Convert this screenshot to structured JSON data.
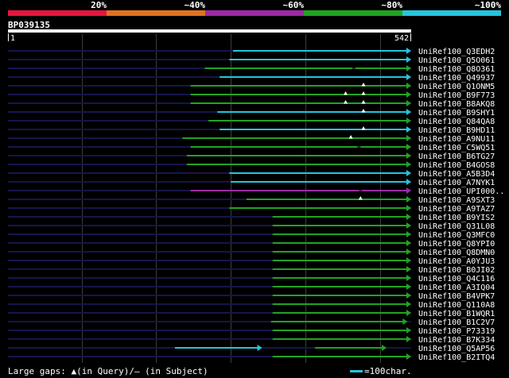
{
  "chart_data": {
    "type": "bar",
    "title": "BP039135",
    "xlim": [
      1,
      542
    ],
    "x_tick_labels": [
      "1",
      "542"
    ],
    "grid": true,
    "grid_interval": 100,
    "query_color": "#ffffff",
    "unaligned_color": "#15154d",
    "identity_scale": [
      {
        "label": "20%",
        "color": "#e6153f"
      },
      {
        "label": "~40%",
        "color": "#e0731f"
      },
      {
        "label": "~60%",
        "color": "#9c2aa3"
      },
      {
        "label": "~80%",
        "color": "#22a322"
      },
      {
        "label": "~100%",
        "color": "#26c4dc"
      }
    ],
    "alignments": [
      {
        "name": "UniRef100_Q3EDH2",
        "segments": [
          {
            "start": 303,
            "end": 542,
            "color": "#26c4dc"
          }
        ]
      },
      {
        "name": "UniRef100_Q5O061",
        "segments": [
          {
            "start": 298,
            "end": 542,
            "color": "#26c4dc"
          }
        ]
      },
      {
        "name": "UniRef100_Q8O361",
        "segments": [
          {
            "start": 265,
            "end": 542,
            "color": "#22a322"
          }
        ],
        "subject_gaps": [
          465
        ]
      },
      {
        "name": "UniRef100_Q49937",
        "segments": [
          {
            "start": 285,
            "end": 542,
            "color": "#26c4dc"
          }
        ]
      },
      {
        "name": "UniRef100_Q1ONM5",
        "segments": [
          {
            "start": 246,
            "end": 542,
            "color": "#22a322"
          }
        ],
        "query_gaps": [
          478
        ]
      },
      {
        "name": "UniRef100_B9F773",
        "segments": [
          {
            "start": 246,
            "end": 542,
            "color": "#22a322"
          }
        ],
        "query_gaps": [
          454,
          478
        ]
      },
      {
        "name": "UniRef100_B8AKQ8",
        "segments": [
          {
            "start": 246,
            "end": 542,
            "color": "#22a322"
          }
        ],
        "query_gaps": [
          454,
          478
        ]
      },
      {
        "name": "UniRef100_B9SHY1",
        "segments": [
          {
            "start": 282,
            "end": 542,
            "color": "#26c4dc"
          }
        ],
        "query_gaps": [
          478
        ]
      },
      {
        "name": "UniRef100_Q84QA8",
        "segments": [
          {
            "start": 270,
            "end": 542,
            "color": "#22a322"
          }
        ]
      },
      {
        "name": "UniRef100_B9HD11",
        "segments": [
          {
            "start": 285,
            "end": 542,
            "color": "#26c4dc"
          }
        ],
        "query_gaps": [
          478
        ]
      },
      {
        "name": "UniRef100_A9NU11",
        "segments": [
          {
            "start": 235,
            "end": 542,
            "color": "#22a322"
          }
        ],
        "query_gaps": [
          461
        ]
      },
      {
        "name": "UniRef100_C5WQ51",
        "segments": [
          {
            "start": 246,
            "end": 542,
            "color": "#22a322"
          }
        ],
        "subject_gaps": [
          472
        ]
      },
      {
        "name": "UniRef100_B6TG27",
        "segments": [
          {
            "start": 241,
            "end": 542,
            "color": "#22a322"
          }
        ]
      },
      {
        "name": "UniRef100_B4GOS8",
        "segments": [
          {
            "start": 241,
            "end": 542,
            "color": "#22a322"
          }
        ]
      },
      {
        "name": "UniRef100_A5B3D4",
        "segments": [
          {
            "start": 298,
            "end": 542,
            "color": "#26c4dc"
          }
        ]
      },
      {
        "name": "UniRef100_A7NYK1",
        "segments": [
          {
            "start": 300,
            "end": 542,
            "color": "#26c4dc"
          }
        ]
      },
      {
        "name": "UniRef100_UPI000..",
        "segments": [
          {
            "start": 246,
            "end": 542,
            "color": "#9c2aa3"
          }
        ],
        "subject_gaps": [
          474
        ]
      },
      {
        "name": "UniRef100_A9SXT3",
        "segments": [
          {
            "start": 321,
            "end": 542,
            "color": "#22a322"
          }
        ],
        "query_gaps": [
          474
        ]
      },
      {
        "name": "UniRef100_A9TAZ7",
        "segments": [
          {
            "start": 298,
            "end": 542,
            "color": "#22a322"
          }
        ]
      },
      {
        "name": "UniRef100_B9YIS2",
        "segments": [
          {
            "start": 356,
            "end": 542,
            "color": "#22a322"
          }
        ]
      },
      {
        "name": "UniRef100_Q31L08",
        "segments": [
          {
            "start": 356,
            "end": 542,
            "color": "#22a322"
          }
        ]
      },
      {
        "name": "UniRef100_Q3MFC0",
        "segments": [
          {
            "start": 356,
            "end": 542,
            "color": "#22a322"
          }
        ]
      },
      {
        "name": "UniRef100_Q8YPI0",
        "segments": [
          {
            "start": 356,
            "end": 542,
            "color": "#22a322"
          }
        ]
      },
      {
        "name": "UniRef100_Q8DMN0",
        "segments": [
          {
            "start": 356,
            "end": 542,
            "color": "#22a322"
          }
        ]
      },
      {
        "name": "UniRef100_A0YJU3",
        "segments": [
          {
            "start": 356,
            "end": 542,
            "color": "#22a322"
          }
        ]
      },
      {
        "name": "UniRef100_B0JI02",
        "segments": [
          {
            "start": 356,
            "end": 542,
            "color": "#22a322"
          }
        ]
      },
      {
        "name": "UniRef100_Q4C116",
        "segments": [
          {
            "start": 356,
            "end": 542,
            "color": "#22a322"
          }
        ]
      },
      {
        "name": "UniRef100_A3IQ04",
        "segments": [
          {
            "start": 356,
            "end": 542,
            "color": "#22a322"
          }
        ]
      },
      {
        "name": "UniRef100_B4VPK7",
        "segments": [
          {
            "start": 356,
            "end": 542,
            "color": "#22a322"
          }
        ]
      },
      {
        "name": "UniRef100_Q110A8",
        "segments": [
          {
            "start": 356,
            "end": 542,
            "color": "#22a322"
          }
        ]
      },
      {
        "name": "UniRef100_B1WQR1",
        "segments": [
          {
            "start": 356,
            "end": 542,
            "color": "#22a322"
          }
        ]
      },
      {
        "name": "UniRef100_B1C2V7",
        "segments": [
          {
            "start": 354,
            "end": 537,
            "color": "#22a322"
          }
        ]
      },
      {
        "name": "UniRef100_P73319",
        "segments": [
          {
            "start": 356,
            "end": 542,
            "color": "#22a322"
          }
        ]
      },
      {
        "name": "UniRef100_B7K334",
        "segments": [
          {
            "start": 356,
            "end": 542,
            "color": "#22a322"
          }
        ]
      },
      {
        "name": "UniRef100_Q5AP56",
        "segments": [
          {
            "start": 225,
            "end": 342,
            "color": "#26c4dc"
          },
          {
            "start": 413,
            "end": 509,
            "color": "#22a322"
          }
        ]
      },
      {
        "name": "UniRef100_B2ITQ4",
        "segments": [
          {
            "start": 356,
            "end": 542,
            "color": "#22a322"
          }
        ]
      }
    ],
    "legend": {
      "gaps_text": "Large gaps: ▲(in Query)/— (in Subject)",
      "scale_text": "=100char.",
      "scale_color": "#26c4dc"
    }
  }
}
